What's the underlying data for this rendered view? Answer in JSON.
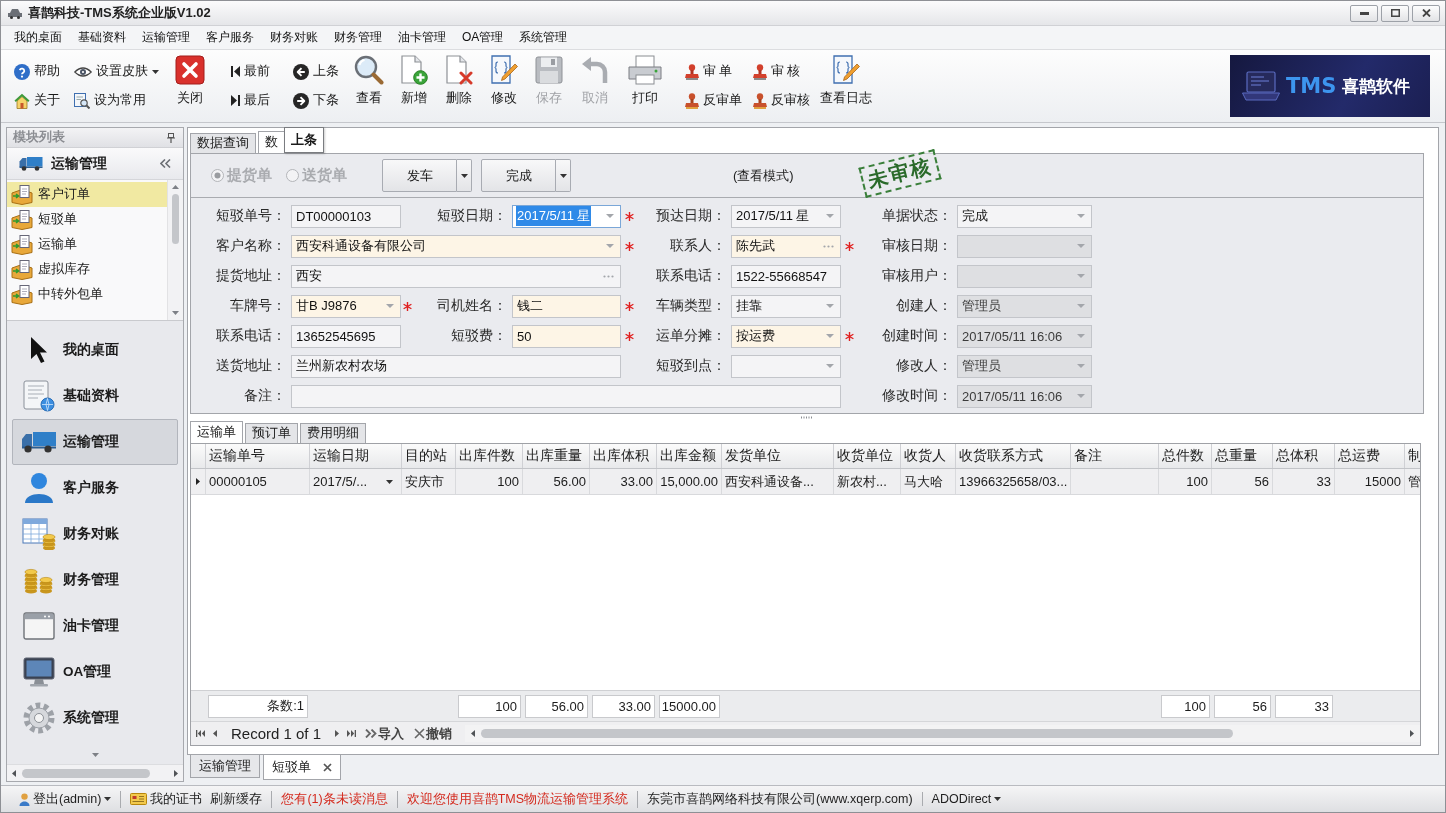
{
  "window": {
    "title": "喜鹊科技-TMS系统企业版V1.02"
  },
  "menu": [
    "我的桌面",
    "基础资料",
    "运输管理",
    "客户服务",
    "财务对账",
    "财务管理",
    "油卡管理",
    "OA管理",
    "系统管理"
  ],
  "toolbar": [
    {
      "kind": "stack",
      "buttons": [
        {
          "label": "帮助",
          "disabled": false,
          "dropdown": false
        },
        {
          "label": "关于",
          "disabled": false,
          "dropdown": false
        }
      ]
    },
    {
      "kind": "stack",
      "buttons": [
        {
          "label": "设置皮肤",
          "disabled": false,
          "dropdown": true
        },
        {
          "label": "设为常用",
          "disabled": false,
          "dropdown": false
        }
      ]
    },
    {
      "kind": "large",
      "buttons": [
        {
          "label": "关闭",
          "disabled": false,
          "dropdown": false
        }
      ]
    },
    {
      "kind": "stack",
      "buttons": [
        {
          "label": "最前",
          "disabled": false,
          "dropdown": false
        },
        {
          "label": "最后",
          "disabled": false,
          "dropdown": false
        }
      ]
    },
    {
      "kind": "stack",
      "buttons": [
        {
          "label": "上条",
          "disabled": false,
          "dropdown": false
        },
        {
          "label": "下条",
          "disabled": false,
          "dropdown": false
        }
      ]
    },
    {
      "kind": "large",
      "buttons": [
        {
          "label": "查看",
          "disabled": false,
          "dropdown": false
        }
      ]
    },
    {
      "kind": "large",
      "buttons": [
        {
          "label": "新增",
          "disabled": false,
          "dropdown": false
        }
      ]
    },
    {
      "kind": "large",
      "buttons": [
        {
          "label": "删除",
          "disabled": false,
          "dropdown": false
        }
      ]
    },
    {
      "kind": "large",
      "buttons": [
        {
          "label": "修改",
          "disabled": false,
          "dropdown": false
        }
      ]
    },
    {
      "kind": "large",
      "buttons": [
        {
          "label": "保存",
          "disabled": true,
          "dropdown": false
        }
      ]
    },
    {
      "kind": "large",
      "buttons": [
        {
          "label": "取消",
          "disabled": true,
          "dropdown": false
        }
      ]
    },
    {
      "kind": "large",
      "buttons": [
        {
          "label": "打印",
          "disabled": false,
          "dropdown": false
        }
      ]
    },
    {
      "kind": "stack",
      "buttons": [
        {
          "label": "审 单",
          "disabled": false,
          "dropdown": false
        },
        {
          "label": "反审单",
          "disabled": false,
          "dropdown": false
        }
      ]
    },
    {
      "kind": "stack",
      "buttons": [
        {
          "label": "审 核",
          "disabled": false,
          "dropdown": false
        },
        {
          "label": "反审核",
          "disabled": false,
          "dropdown": false
        }
      ]
    },
    {
      "kind": "large",
      "buttons": [
        {
          "label": "查看日志",
          "disabled": false,
          "dropdown": false
        }
      ]
    }
  ],
  "logo": {
    "brand": "TMS",
    "name": "喜鹊软件"
  },
  "sidebar": {
    "title": "模块列表",
    "section": "运输管理",
    "items": [
      {
        "label": "客户订单",
        "selected": true
      },
      {
        "label": "短驳单",
        "selected": false
      },
      {
        "label": "运输单",
        "selected": false
      },
      {
        "label": "虚拟库存",
        "selected": false
      },
      {
        "label": "中转外包单",
        "selected": false
      }
    ],
    "nav": [
      {
        "label": "我的桌面",
        "selected": false
      },
      {
        "label": "基础资料",
        "selected": false
      },
      {
        "label": "运输管理",
        "selected": true
      },
      {
        "label": "客户服务",
        "selected": false
      },
      {
        "label": "财务对账",
        "selected": false
      },
      {
        "label": "财务管理",
        "selected": false
      },
      {
        "label": "油卡管理",
        "selected": false
      },
      {
        "label": "OA管理",
        "selected": false
      },
      {
        "label": "系统管理",
        "selected": false
      }
    ]
  },
  "doc_tabs": [
    {
      "label": "数据查询",
      "selected": false
    },
    {
      "label": "数",
      "selected": true
    }
  ],
  "tooltip": "上条",
  "form": {
    "radios": [
      {
        "label": "提货单",
        "selected": true,
        "disabled": true
      },
      {
        "label": "送货单",
        "selected": false,
        "disabled": true
      }
    ],
    "actions": [
      "发车",
      "完成"
    ],
    "mode": "(查看模式)",
    "stamp": "未审核",
    "fields": [
      {
        "label": "短驳单号：",
        "value": "DT00000103",
        "kind": "text",
        "required": false,
        "disabled": false,
        "focused": false
      },
      {
        "label": "短驳日期：",
        "value": "2017/5/11 星",
        "kind": "combo",
        "required": true,
        "disabled": false,
        "focused": true
      },
      {
        "label": "预达日期：",
        "value": "2017/5/11 星",
        "kind": "combo",
        "required": false,
        "disabled": false,
        "focused": false
      },
      {
        "label": "单据状态：",
        "value": "完成",
        "kind": "combo",
        "required": false,
        "disabled": false,
        "focused": false
      },
      {
        "label": "客户名称：",
        "value": "西安科通设备有限公司",
        "kind": "combo",
        "required": true,
        "disabled": false,
        "focused": false
      },
      {
        "label": "联系人：",
        "value": "陈先武",
        "kind": "picker",
        "required": true,
        "disabled": false,
        "focused": false
      },
      {
        "label": "审核日期：",
        "kind": "combo",
        "required": false,
        "disabled": true,
        "focused": false
      },
      {
        "label": "提货地址：",
        "value": "西安",
        "kind": "picker",
        "required": false,
        "disabled": false,
        "focused": false
      },
      {
        "label": "联系电话：",
        "value": "1522-55668547",
        "kind": "text",
        "required": false,
        "disabled": false,
        "focused": false
      },
      {
        "label": "审核用户：",
        "kind": "combo",
        "required": false,
        "disabled": true,
        "focused": false
      },
      {
        "label": "车牌号：",
        "value": "甘B J9876",
        "kind": "combo",
        "required": true,
        "disabled": false,
        "focused": false
      },
      {
        "label": "司机姓名：",
        "value": "钱二",
        "kind": "text",
        "required": true,
        "disabled": false,
        "focused": false
      },
      {
        "label": "车辆类型：",
        "value": "挂靠",
        "kind": "combo",
        "required": false,
        "disabled": false,
        "focused": false
      },
      {
        "label": "创建人：",
        "value": "管理员",
        "kind": "combo",
        "required": false,
        "disabled": true,
        "focused": false
      },
      {
        "label": "联系电话：",
        "value": "13652545695",
        "kind": "text",
        "required": false,
        "disabled": false,
        "focused": false
      },
      {
        "label": "短驳费：",
        "value": "50",
        "kind": "text",
        "required": true,
        "disabled": false,
        "focused": false
      },
      {
        "label": "运单分摊：",
        "value": "按运费",
        "kind": "combo",
        "required": true,
        "disabled": false,
        "focused": false
      },
      {
        "label": "创建时间：",
        "value": "2017/05/11 16:06",
        "kind": "combo",
        "required": false,
        "disabled": true,
        "focused": false
      },
      {
        "label": "送货地址：",
        "value": "兰州新农村农场",
        "kind": "text",
        "required": false,
        "disabled": false,
        "focused": false
      },
      {
        "label": "短驳到点：",
        "kind": "combo",
        "required": false,
        "disabled": false,
        "focused": false
      },
      {
        "label": "修改人：",
        "value": "管理员",
        "kind": "combo",
        "required": false,
        "disabled": true,
        "focused": false
      },
      {
        "label": "备注：",
        "kind": "text",
        "required": false,
        "disabled": false,
        "focused": false
      },
      {
        "label": "修改时间：",
        "value": "2017/05/11 16:06",
        "kind": "combo",
        "required": false,
        "disabled": true,
        "focused": false
      }
    ]
  },
  "detail_tabs": [
    {
      "label": "运输单",
      "selected": true
    },
    {
      "label": "预订单",
      "selected": false
    },
    {
      "label": "费用明细",
      "selected": false
    }
  ],
  "grid": {
    "columns": [
      {
        "label": "运输单号",
        "kind": "text",
        "total": "条数:1"
      },
      {
        "label": "运输日期",
        "kind": "date"
      },
      {
        "label": "目的站",
        "kind": "text"
      },
      {
        "label": "出库件数",
        "kind": "number",
        "total": "100"
      },
      {
        "label": "出库重量",
        "kind": "number",
        "total": "56.00"
      },
      {
        "label": "出库体积",
        "kind": "number",
        "total": "33.00"
      },
      {
        "label": "出库金额",
        "kind": "number",
        "total": "15000.00"
      },
      {
        "label": "发货单位",
        "kind": "text"
      },
      {
        "label": "收货单位",
        "kind": "text"
      },
      {
        "label": "收货人",
        "kind": "text"
      },
      {
        "label": "收货联系方式",
        "kind": "text"
      },
      {
        "label": "备注",
        "kind": "text"
      },
      {
        "label": "总件数",
        "kind": "number",
        "total": "100"
      },
      {
        "label": "总重量",
        "kind": "number",
        "total": "56"
      },
      {
        "label": "总体积",
        "kind": "number",
        "total": "33"
      },
      {
        "label": "总运费",
        "kind": "number"
      },
      {
        "label": "制",
        "kind": "text"
      }
    ],
    "rows": [
      {
        "current": true,
        "cells": [
          "00000105",
          "2017/5/...",
          "安庆市",
          "100",
          "56.00",
          "33.00",
          "15,000.00",
          "西安科通设备...",
          "新农村...",
          "马大哈",
          "13966325658/03...",
          "",
          "100",
          "56",
          "33",
          "15000",
          "管"
        ]
      }
    ],
    "navigator": {
      "record": "Record 1 of 1",
      "actions": [
        "导入",
        "撤销"
      ]
    }
  },
  "bottom_tabs": [
    {
      "label": "运输管理",
      "selected": false,
      "closable": false
    },
    {
      "label": "短驳单",
      "selected": true,
      "closable": true
    }
  ],
  "status_bar": [
    [
      {
        "label": "登出(admin)",
        "kind": "user-menu"
      }
    ],
    [
      {
        "label": "我的证书",
        "kind": "certificate"
      },
      {
        "label": "刷新缓存",
        "kind": "button"
      }
    ],
    [
      {
        "label": "您有(1)条未读消息",
        "kind": "notice"
      }
    ],
    [
      {
        "label": "欢迎您使用喜鹊TMS物流运输管理系统",
        "kind": "banner"
      }
    ],
    [
      {
        "label": "东莞市喜鹊网络科技有限公司(www.xqerp.com)",
        "kind": "text"
      }
    ],
    [
      {
        "label": "ADODirect",
        "kind": "menu"
      }
    ]
  ]
}
